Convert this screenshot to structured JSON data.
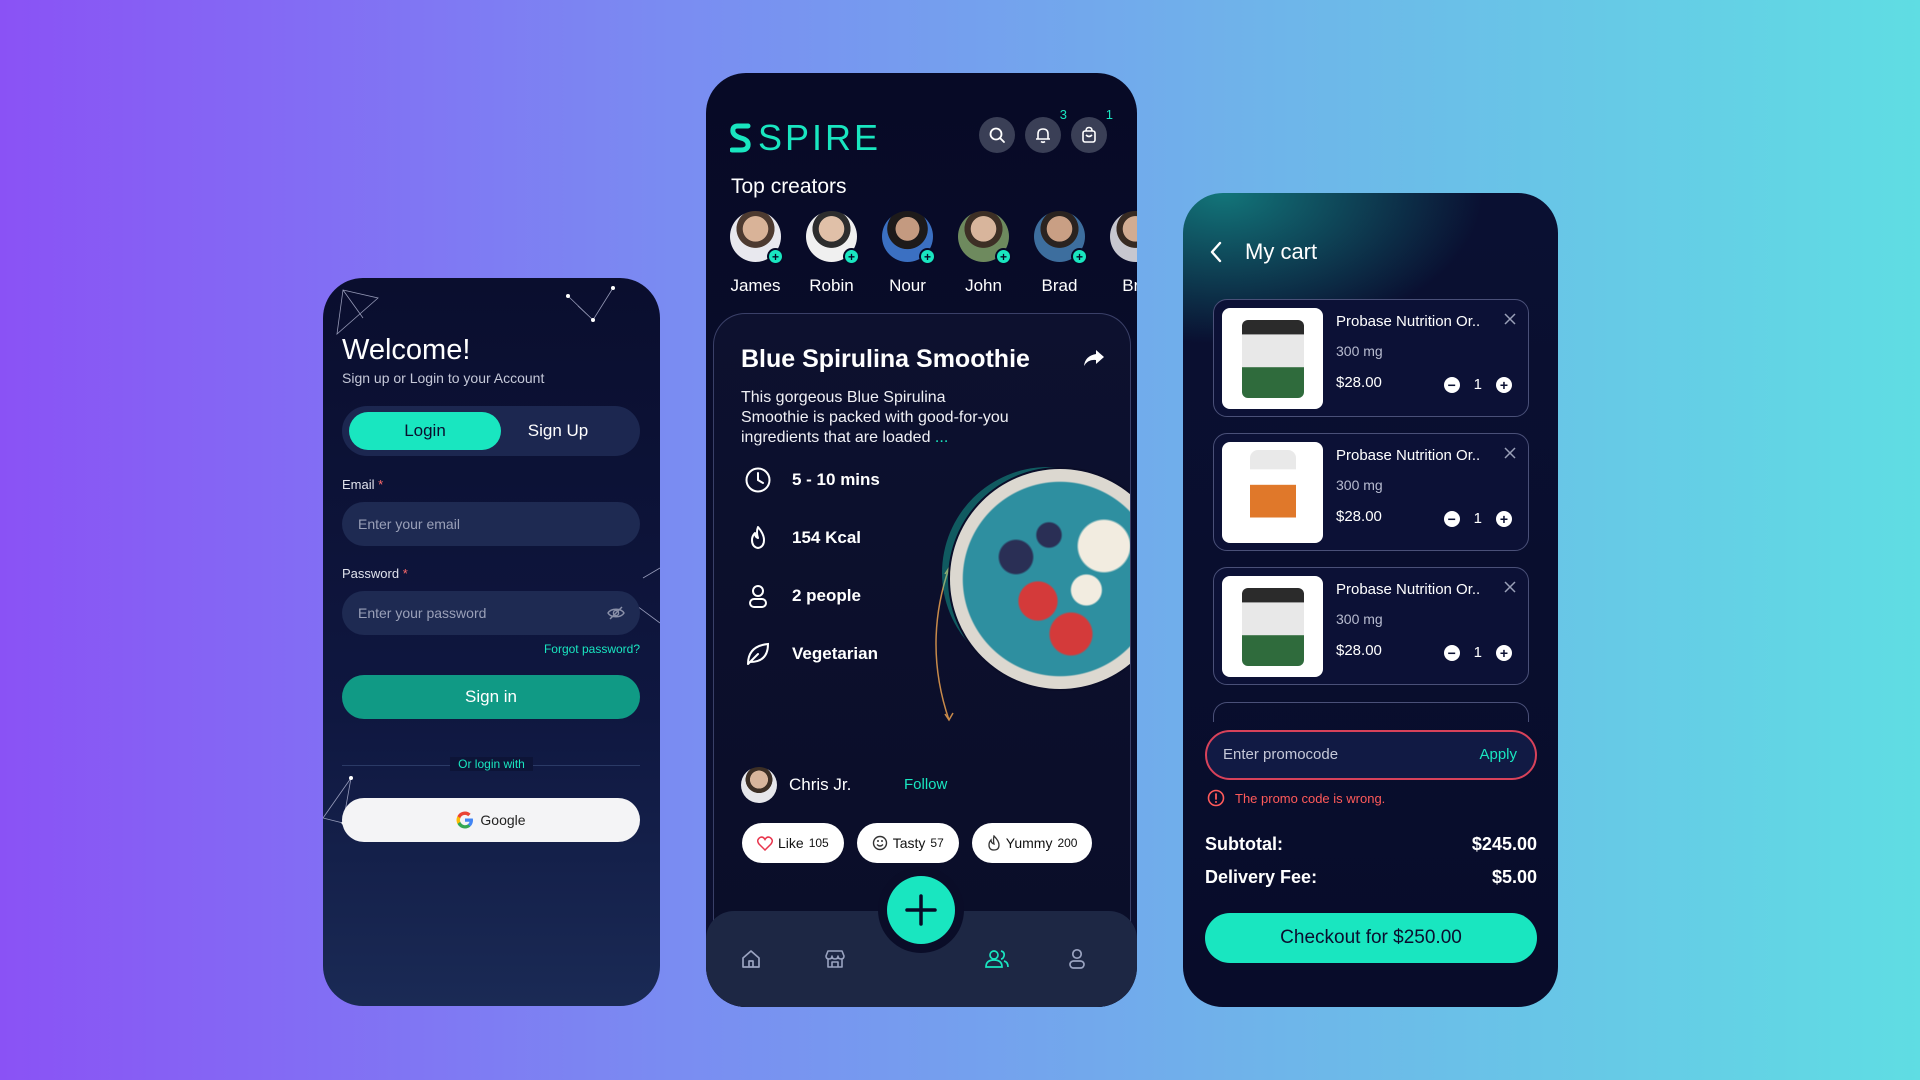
{
  "colors": {
    "accent": "#19e6c0",
    "panel_dark": "#0a0e2e",
    "error": "#ff5a5a",
    "signin_button": "#109a85"
  },
  "login": {
    "title": "Welcome!",
    "subtitle": "Sign up or Login to your Account",
    "tab_login": "Login",
    "tab_signup": "Sign Up",
    "email_label": "Email",
    "email_placeholder": "Enter your email",
    "password_label": "Password",
    "password_placeholder": "Enter your password",
    "required_mark": "*",
    "forgot_password": "Forgot password?",
    "signin": "Sign in",
    "or_login_with": "Or login with",
    "google": "Google",
    "icons": [
      "eye-off-icon",
      "google-icon"
    ]
  },
  "recipe_app": {
    "brand": "SPIRE",
    "notifications_count": "3",
    "cart_count": "1",
    "top_creators_title": "Top creators",
    "creators": [
      "James",
      "Robin",
      "Nour",
      "John",
      "Brad",
      "Bra"
    ],
    "recipe": {
      "title": "Blue Spirulina Smoothie",
      "description": "This gorgeous Blue Spirulina Smoothie is packed with good-for-you ingredients that are loaded",
      "more": "...",
      "stats": {
        "time": "5 - 10 mins",
        "calories": "154 Kcal",
        "servings": "2 people",
        "diet": "Vegetarian"
      },
      "author": "Chris Jr.",
      "follow": "Follow",
      "reactions": {
        "like_label": "Like",
        "like_count": "105",
        "tasty_label": "Tasty",
        "tasty_count": "57",
        "yummy_label": "Yummy",
        "yummy_count": "200"
      }
    },
    "nav_icons": [
      "home-icon",
      "store-icon",
      "add-icon",
      "community-icon",
      "profile-icon"
    ]
  },
  "cart": {
    "title": "My cart",
    "items": [
      {
        "name": "Probase Nutrition Or..",
        "dose": "300 mg",
        "price": "$28.00",
        "qty": "1"
      },
      {
        "name": "Probase Nutrition Or..",
        "dose": "300 mg",
        "price": "$28.00",
        "qty": "1"
      },
      {
        "name": "Probase Nutrition Or..",
        "dose": "300 mg",
        "price": "$28.00",
        "qty": "1"
      }
    ],
    "promo_placeholder": "Enter promocode",
    "apply": "Apply",
    "promo_error": "The promo code is wrong.",
    "subtotal_label": "Subtotal:",
    "subtotal_value": "$245.00",
    "delivery_label": "Delivery Fee:",
    "delivery_value": "$5.00",
    "checkout": "Checkout for $250.00"
  }
}
